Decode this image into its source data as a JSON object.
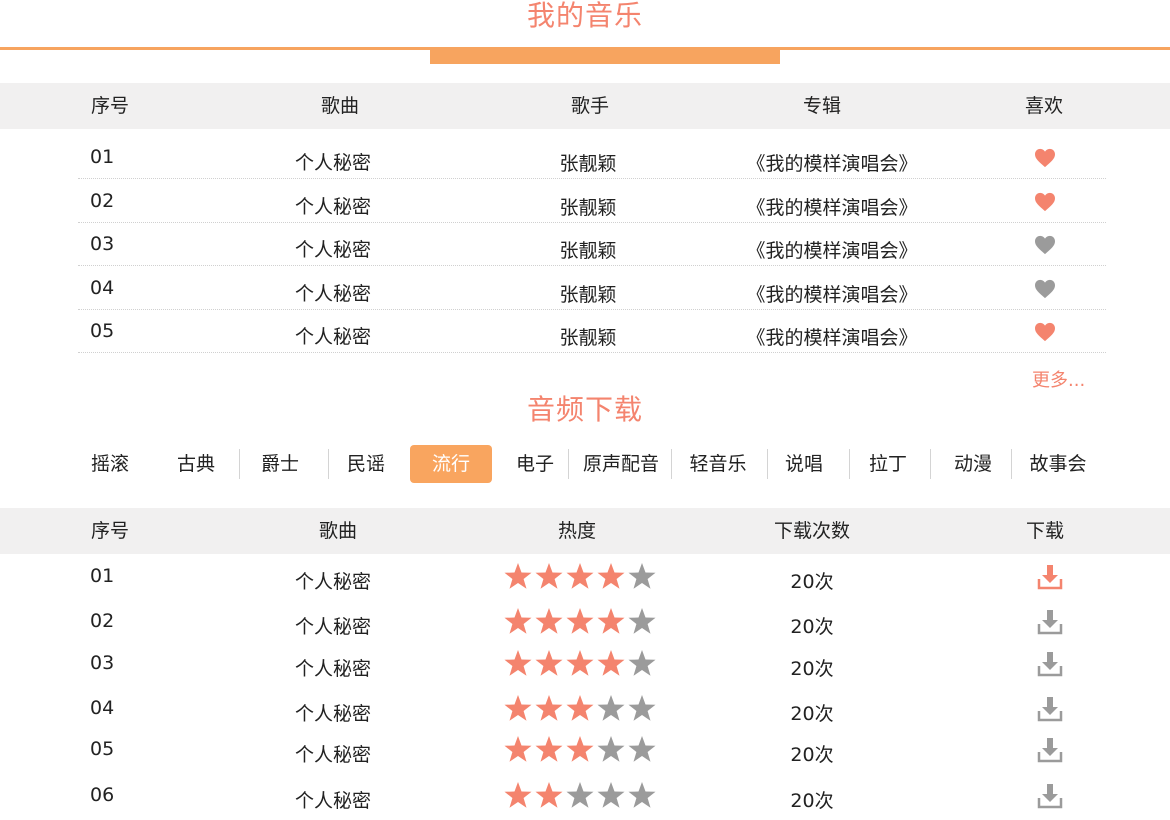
{
  "my_music": {
    "title": "我的音乐",
    "headers": {
      "index": "序号",
      "song": "歌曲",
      "singer": "歌手",
      "album": "专辑",
      "like": "喜欢"
    },
    "rows": [
      {
        "index": "01",
        "song": "个人秘密",
        "singer": "张靓颖",
        "album": "《我的模样演唱会》",
        "liked": true
      },
      {
        "index": "02",
        "song": "个人秘密",
        "singer": "张靓颖",
        "album": "《我的模样演唱会》",
        "liked": true
      },
      {
        "index": "03",
        "song": "个人秘密",
        "singer": "张靓颖",
        "album": "《我的模样演唱会》",
        "liked": false
      },
      {
        "index": "04",
        "song": "个人秘密",
        "singer": "张靓颖",
        "album": "《我的模样演唱会》",
        "liked": false
      },
      {
        "index": "05",
        "song": "个人秘密",
        "singer": "张靓颖",
        "album": "《我的模样演唱会》",
        "liked": true
      }
    ],
    "more_label": "更多..."
  },
  "audio_download": {
    "title": "音频下载",
    "categories": [
      "摇滚",
      "古典",
      "爵士",
      "民谣",
      "流行",
      "电子",
      "原声配音",
      "轻音乐",
      "说唱",
      "拉丁",
      "动漫",
      "故事会"
    ],
    "active_category": "流行",
    "headers": {
      "index": "序号",
      "song": "歌曲",
      "heat": "热度",
      "downloads": "下载次数",
      "download": "下载"
    },
    "rows": [
      {
        "index": "01",
        "song": "个人秘密",
        "rating": 4,
        "downloads": "20次",
        "highlighted": true
      },
      {
        "index": "02",
        "song": "个人秘密",
        "rating": 4,
        "downloads": "20次",
        "highlighted": false
      },
      {
        "index": "03",
        "song": "个人秘密",
        "rating": 4,
        "downloads": "20次",
        "highlighted": false
      },
      {
        "index": "04",
        "song": "个人秘密",
        "rating": 3,
        "downloads": "20次",
        "highlighted": false
      },
      {
        "index": "05",
        "song": "个人秘密",
        "rating": 3,
        "downloads": "20次",
        "highlighted": false
      },
      {
        "index": "06",
        "song": "个人秘密",
        "rating": 2,
        "downloads": "20次",
        "highlighted": false
      }
    ],
    "max_rating": 5
  },
  "colors": {
    "accent": "#f4846e",
    "orange": "#f7a45f",
    "active_tab": "#f9a55f",
    "inactive_icon": "#9b9b9b",
    "header_bg": "#f1f0f0"
  }
}
